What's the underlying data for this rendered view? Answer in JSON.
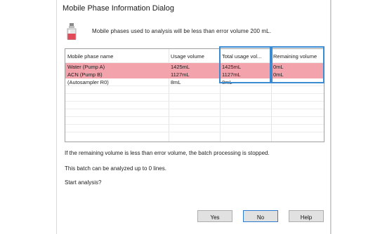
{
  "window": {
    "title": "Mobile Phase Information Dialog"
  },
  "message": "Mobile phases used to analysis will be less than error volume 200 mL.",
  "table": {
    "headers": [
      "Mobile phase name",
      "Usage volume",
      "Total usage vol...",
      "Remaining volume"
    ],
    "rows": [
      {
        "name": "Water (Pump A)",
        "usage": "1425mL",
        "total": "1425mL",
        "remaining": "0mL",
        "alert": true
      },
      {
        "name": "ACN (Pump B)",
        "usage": "1127mL",
        "total": "1127mL",
        "remaining": "0mL",
        "alert": true
      },
      {
        "name": "(Autosampler R0)",
        "usage": "8mL",
        "total": "8mL",
        "remaining": "---",
        "alert": false
      }
    ]
  },
  "info": {
    "line1": "If the remaining volume is less than error volume, the batch processing is stopped.",
    "line2": "This batch can be analyzed up to 0 lines.",
    "line3": "Start analysis?"
  },
  "buttons": {
    "yes": "Yes",
    "no": "No",
    "help": "Help"
  },
  "colors": {
    "alert_row": "#f2a3ab",
    "highlight_box": "#3a8bd1",
    "default_button_border": "#2f7bd0"
  },
  "icons": {
    "warning": "bottle-warning-icon"
  }
}
